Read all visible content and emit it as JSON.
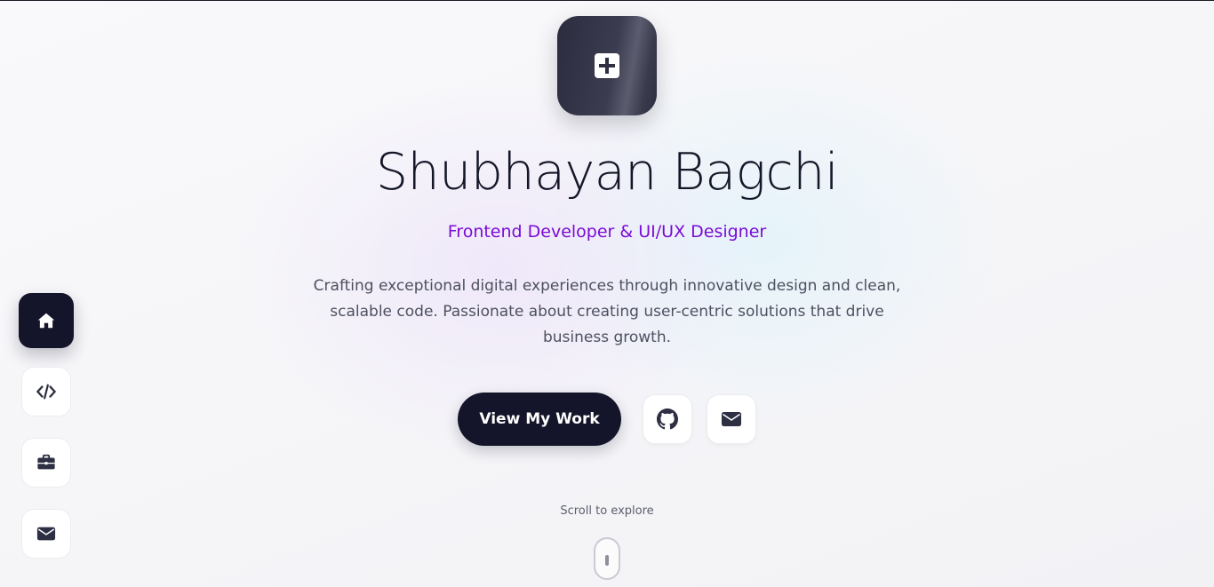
{
  "hero": {
    "name": "Shubhayan Bagchi",
    "role": "Frontend Developer & UI/UX Designer",
    "description": "Crafting exceptional digital experiences through innovative design and clean, scalable code. Passionate about creating user-centric solutions that drive business growth.",
    "cta_label": "View My Work"
  },
  "logo": {
    "icon": "plus-square-icon"
  },
  "social": [
    {
      "icon": "github-icon"
    },
    {
      "icon": "envelope-icon"
    }
  ],
  "side_nav": {
    "items": [
      {
        "icon": "home-icon",
        "active": true
      },
      {
        "icon": "code-icon",
        "active": false
      },
      {
        "icon": "briefcase-icon",
        "active": false
      },
      {
        "icon": "envelope-icon",
        "active": false
      }
    ]
  },
  "scroll_hint": {
    "label": "Scroll to explore",
    "icon": "mouse-icon"
  },
  "colors": {
    "accent": "#7a0bd6",
    "dark": "#14152a",
    "text_muted": "#4d5060",
    "background": "#f7f7fa"
  }
}
